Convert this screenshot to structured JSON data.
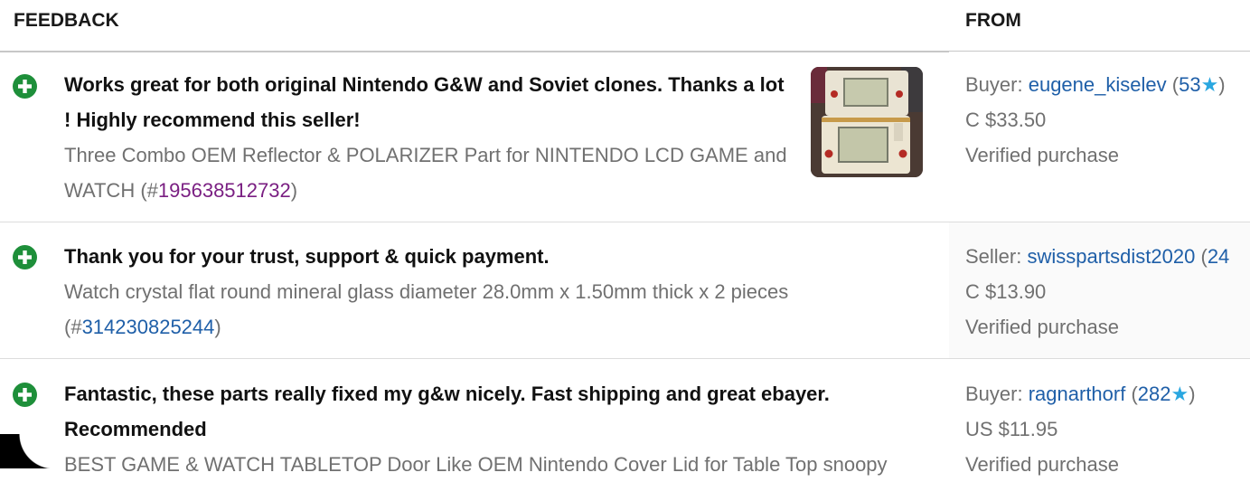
{
  "header": {
    "feedback_label": "FEEDBACK",
    "from_label": "FROM"
  },
  "rows": [
    {
      "comment": "Works great for both original Nintendo G&W and Soviet clones. Thanks a lot ! Highly recommend this seller!",
      "item_title": "Three Combo OEM Reflector & POLARIZER Part for NINTENDO LCD GAME and WATCH",
      "item_number": "195638512732",
      "role": "Buyer:",
      "username": "eugene_kiselev",
      "score": "53",
      "price": "C $33.50",
      "verified": "Verified purchase",
      "rating_icon": "positive-plus-icon",
      "accent": "#1e8f3a"
    },
    {
      "comment": "Thank you for your trust, support & quick payment.",
      "item_title": "Watch crystal flat round mineral glass diameter 28.0mm x 1.50mm thick x 2 pieces",
      "item_number": "314230825244",
      "role": "Seller:",
      "username": "swisspartsdist2020",
      "score": "24",
      "price": "C $13.90",
      "verified": "Verified purchase",
      "rating_icon": "positive-plus-icon"
    },
    {
      "comment": "Fantastic, these parts really fixed my g&w nicely. Fast shipping and great ebayer. Recommended",
      "item_title": "BEST GAME & WATCH TABLETOP Door Like OEM Nintendo Cover Lid for Table Top snoopy",
      "role": "Buyer:",
      "username": "ragnarthorf",
      "score": "282",
      "price": "US $11.95",
      "verified": "Verified purchase",
      "rating_icon": "positive-plus-icon"
    }
  ],
  "colors": {
    "positive": "#1e8f3a",
    "link": "#1f5fa8",
    "visited_link": "#7a1f82",
    "star": "#2aa7e0"
  }
}
